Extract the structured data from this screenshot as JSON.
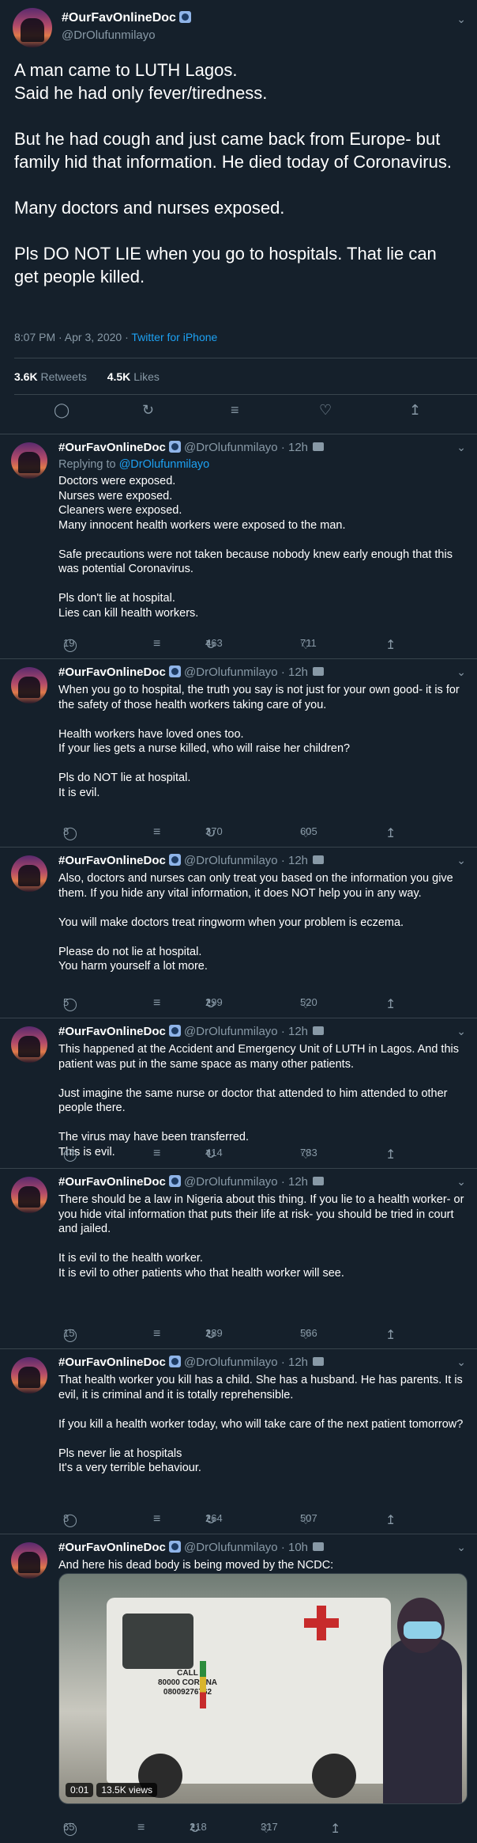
{
  "author": {
    "name": "#OurFavOnlineDoc",
    "handle": "@DrOlufunmilayo"
  },
  "main": {
    "paragraphs": [
      "A man came to LUTH Lagos.\nSaid he had only fever/tiredness.",
      "But he had cough and just came back from Europe- but family hid that information. He died today of Coronavirus.",
      "Many doctors and nurses exposed.",
      "Pls DO NOT LIE when you go to hospitals. That lie can get people killed."
    ],
    "timestamp": "8:07 PM · Apr 3, 2020 · ",
    "source": "Twitter for iPhone",
    "retweets_count": "3.6K",
    "retweets_label": "Retweets",
    "likes_count": "4.5K",
    "likes_label": "Likes"
  },
  "replies": [
    {
      "time": "· 12h",
      "replying_label": "Replying to ",
      "replying_to": "@DrOlufunmilayo",
      "paragraphs": [
        "Doctors were exposed.\nNurses were exposed.\nCleaners were exposed.\nMany innocent health workers were exposed to the man.",
        "Safe precautions were not taken because nobody knew early enough that this was potential Coronavirus.",
        "Pls don't lie at hospital.\nLies can kill health workers."
      ],
      "replies": "19",
      "retweets": "463",
      "likes": "711"
    },
    {
      "time": "· 12h",
      "paragraphs": [
        "When you go to hospital, the truth you say is not just for your own good- it is for the safety of those health workers taking care of you.",
        "Health workers have loved ones too.\nIf your lies gets a nurse killed, who will raise her children?",
        "Pls do NOT lie at hospital.\nIt is evil."
      ],
      "replies": "8",
      "retweets": "370",
      "likes": "605"
    },
    {
      "time": "· 12h",
      "paragraphs": [
        "Also, doctors and nurses can only treat you based on the information you give them. If you hide any vital information, it does NOT help you in any way.",
        "You will make doctors treat ringworm when your problem is eczema.",
        "Please do not lie at hospital.\nYou harm yourself a lot more."
      ],
      "replies": "5",
      "retweets": "299",
      "likes": "520"
    },
    {
      "time": "· 12h",
      "paragraphs": [
        "This happened at the Accident and Emergency Unit of LUTH in Lagos. And this patient was put in the same space as many other patients.",
        "Just imagine the same nurse or doctor that attended to him attended to other people there.",
        "The virus may have been transferred.\nThis is evil."
      ],
      "replies": "44",
      "retweets": "414",
      "likes": "783"
    },
    {
      "time": "· 12h",
      "paragraphs": [
        "There should be a law in Nigeria about this thing. If you lie to a health worker- or you hide vital information that puts their life at risk- you should be tried in court and jailed.",
        "It is evil to the health worker.\nIt is evil to other patients who that health worker will see."
      ],
      "replies": "15",
      "retweets": "289",
      "likes": "566"
    },
    {
      "time": "· 12h",
      "paragraphs": [
        "That health worker you kill has a child. She has a husband. He has parents. It is evil, it is criminal and it is totally reprehensible.",
        "If you kill a health worker today, who will take care of the next patient tomorrow?",
        "Pls never lie at hospitals\nIt's a very terrible behaviour."
      ],
      "replies": "8",
      "retweets": "264",
      "likes": "507"
    },
    {
      "time": "· 10h",
      "paragraphs": [
        "And here his dead body is being moved by the NCDC:"
      ],
      "replies": "65",
      "retweets": "218",
      "likes": "317"
    }
  ],
  "video": {
    "duration": "0:01",
    "views": "13.5K views",
    "vehicle_text": "CALL\n80000 CORONA\n08009276762"
  },
  "icons": {
    "reply": "comment-icon",
    "retweet": "retweet-icon",
    "like": "heart-icon",
    "share": "share-icon",
    "stack": "stack-icon"
  },
  "colors": {
    "background": "#15202b",
    "muted": "#8899a6",
    "link": "#1da1f2",
    "divider": "#38444d"
  }
}
